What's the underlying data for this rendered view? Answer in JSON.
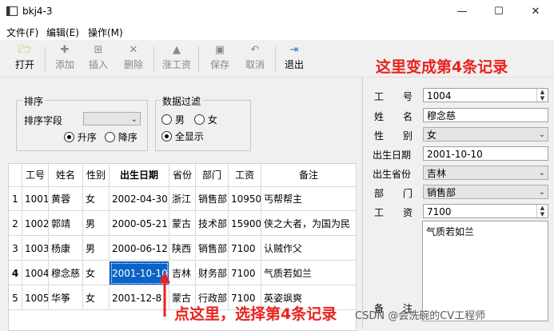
{
  "window": {
    "title": "bkj4-3",
    "minimize": "—",
    "maximize": "☐",
    "close": "✕"
  },
  "menu": [
    "文件(F)",
    "编辑(E)",
    "操作(M)"
  ],
  "toolbar": [
    {
      "label": "打开",
      "icon": "folder-open-icon",
      "glyph": "🗁",
      "enabled": true
    },
    {
      "label": "添加",
      "icon": "plus-icon",
      "glyph": "✚",
      "enabled": false
    },
    {
      "label": "插入",
      "icon": "insert-icon",
      "glyph": "⊞",
      "enabled": false
    },
    {
      "label": "删除",
      "icon": "delete-icon",
      "glyph": "✕",
      "enabled": false
    },
    {
      "label": "涨工资",
      "icon": "arrow-up-icon",
      "glyph": "▲",
      "enabled": false
    },
    {
      "label": "保存",
      "icon": "save-icon",
      "glyph": "▣",
      "enabled": false
    },
    {
      "label": "取消",
      "icon": "undo-icon",
      "glyph": "↶",
      "enabled": false
    },
    {
      "label": "退出",
      "icon": "exit-icon",
      "glyph": "⇥",
      "enabled": true
    }
  ],
  "annotations": {
    "top": "这里变成第4条记录",
    "bottom": "点这里，选择第4条记录"
  },
  "watermark": "CSDN @会洗碗的CV工程师",
  "sort_group": {
    "title": "排序",
    "field_label": "排序字段",
    "field_value": "",
    "asc": "升序",
    "desc": "降序",
    "selected": "asc"
  },
  "filter_group": {
    "title": "数据过滤",
    "male": "男",
    "female": "女",
    "all": "全显示",
    "selected": "all"
  },
  "table": {
    "headers": [
      "工号",
      "姓名",
      "性别",
      "出生日期",
      "省份",
      "部门",
      "工资",
      "备注"
    ],
    "rows": [
      {
        "num": "1",
        "cells": [
          "1001",
          "黄蓉",
          "女",
          "2002-04-30",
          "浙江",
          "销售部",
          "10950",
          "丐帮帮主"
        ]
      },
      {
        "num": "2",
        "cells": [
          "1002",
          "郭靖",
          "男",
          "2000-05-21",
          "蒙古",
          "技术部",
          "15900",
          "侠之大者，为国为民"
        ]
      },
      {
        "num": "3",
        "cells": [
          "1003",
          "杨康",
          "男",
          "2000-06-12",
          "陕西",
          "销售部",
          "7100",
          "认贼作父"
        ]
      },
      {
        "num": "4",
        "cells": [
          "1004",
          "穆念慈",
          "女",
          "2001-10-10",
          "吉林",
          "财务部",
          "7100",
          "气质若如兰"
        ]
      },
      {
        "num": "5",
        "cells": [
          "1005",
          "华筝",
          "女",
          "2001-12-8",
          "蒙古",
          "行政部",
          "7100",
          "英姿飒爽"
        ]
      }
    ],
    "current_row": 4,
    "selected_cell": "2001-10-10"
  },
  "form": {
    "id_label": "工　　号",
    "id_value": "1004",
    "name_label": "姓　　名",
    "name_value": "穆念慈",
    "gender_label": "性　　别",
    "gender_value": "女",
    "birth_label": "出生日期",
    "birth_value": "2001-10-10",
    "province_label": "出生省份",
    "province_value": "吉林",
    "dept_label": "部　　门",
    "dept_value": "销售部",
    "salary_label": "工　　资",
    "salary_value": "7100",
    "notes_label": "备　　注",
    "notes_value": "气质若如兰"
  }
}
